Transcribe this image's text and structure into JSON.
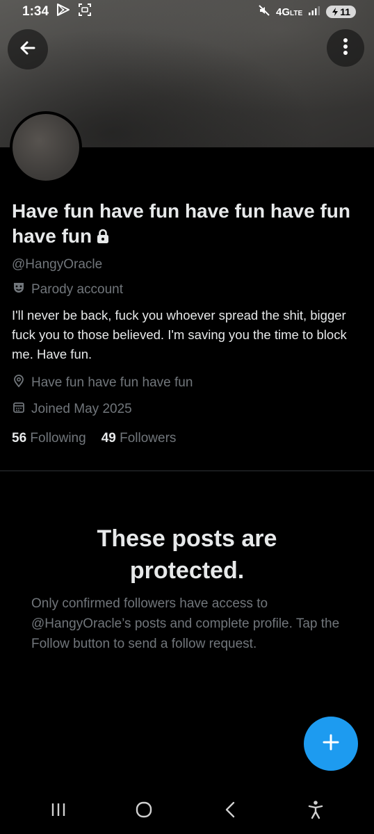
{
  "status_bar": {
    "time": "1:34",
    "network": "4G",
    "network_sub": "LTE",
    "battery": "11"
  },
  "profile": {
    "name": "Have fun have fun have fun have fun have fun",
    "handle": "@HangyOracle",
    "parody_label": "Parody account",
    "bio": "I'll never be back, fuck you whoever spread the shit, bigger fuck you to those believed. I'm saving you the time to block me.  Have fun.",
    "location": "Have fun have fun have fun",
    "joined": "Joined May 2025",
    "following_count": "56",
    "following_label": "Following",
    "followers_count": "49",
    "followers_label": "Followers"
  },
  "protected": {
    "title": "These posts are protected.",
    "body": "Only confirmed followers have access to @HangyOracle’s posts and complete profile. Tap the Follow button to send a follow request."
  },
  "colors": {
    "background": "#000000",
    "text_primary": "#e7e9ea",
    "text_secondary": "#71767b",
    "accent": "#1d9bf0",
    "divider": "#2f3336"
  },
  "icons": {
    "back": "arrow-left-icon",
    "more": "more-vertical-icon",
    "lock": "lock-icon",
    "parody": "theater-mask-icon",
    "location": "location-pin-icon",
    "calendar": "calendar-icon",
    "compose": "plus-icon",
    "nav_recents": "recents-icon",
    "nav_home": "home-icon",
    "nav_back": "nav-back-icon",
    "accessibility": "accessibility-icon"
  }
}
